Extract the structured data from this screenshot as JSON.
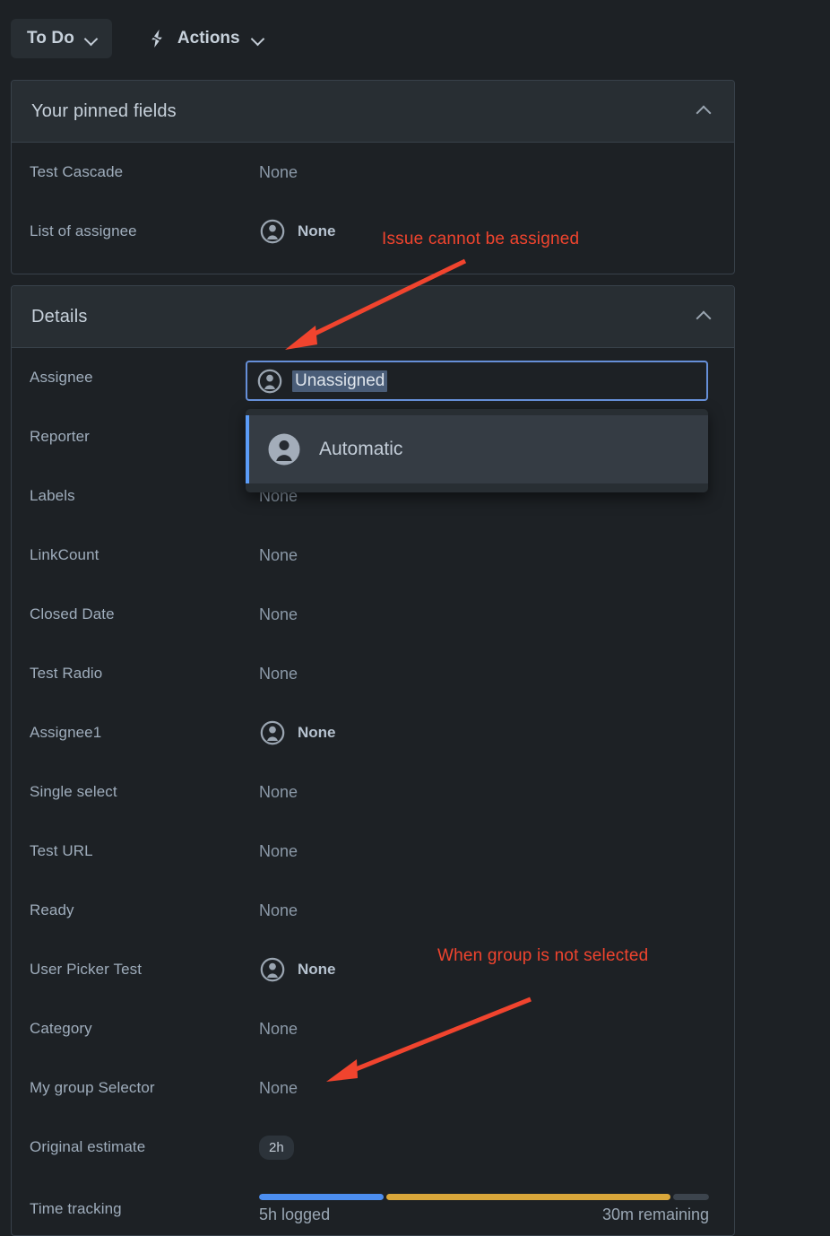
{
  "toolbar": {
    "status_label": "To Do",
    "status_chevron": "chevron-down-icon",
    "actions_label": "Actions",
    "actions_icon": "lightning-bolt-icon",
    "actions_chevron": "chevron-down-icon"
  },
  "pinned_panel": {
    "title": "Your pinned fields",
    "collapse_icon": "chevron-up-icon",
    "rows": [
      {
        "label": "Test Cascade",
        "value": "None",
        "avatar": false
      },
      {
        "label": "List of assignee",
        "value": "None",
        "avatar": true
      }
    ]
  },
  "details_panel": {
    "title": "Details",
    "collapse_icon": "chevron-up-icon",
    "rows": [
      {
        "label": "Assignee",
        "value": "",
        "avatar": false
      },
      {
        "label": "Reporter",
        "value": "",
        "avatar": false
      },
      {
        "label": "Labels",
        "value": "None",
        "avatar": false
      },
      {
        "label": "LinkCount",
        "value": "None",
        "avatar": false
      },
      {
        "label": "Closed Date",
        "value": "None",
        "avatar": false
      },
      {
        "label": "Test Radio",
        "value": "None",
        "avatar": false
      },
      {
        "label": "Assignee1",
        "value": "None",
        "avatar": true
      },
      {
        "label": "Single select",
        "value": "None",
        "avatar": false
      },
      {
        "label": "Test URL",
        "value": "None",
        "avatar": false
      },
      {
        "label": "Ready",
        "value": "None",
        "avatar": false
      },
      {
        "label": "User Picker Test",
        "value": "None",
        "avatar": true
      },
      {
        "label": "Category",
        "value": "None",
        "avatar": false
      },
      {
        "label": "My group Selector",
        "value": "None",
        "avatar": false
      }
    ],
    "original_estimate": {
      "label": "Original estimate",
      "value": "2h"
    },
    "time_tracking": {
      "label": "Time tracking",
      "logged": "5h logged",
      "remaining": "30m remaining",
      "segments": [
        {
          "name": "logged",
          "percent": 28,
          "color": "#4c8ef0"
        },
        {
          "name": "spent",
          "percent": 64,
          "color": "#d9a73a"
        },
        {
          "name": "remaining",
          "percent": 8,
          "color": "#3c444d"
        }
      ]
    }
  },
  "assignee_combobox": {
    "value": "Unassigned",
    "avatar_icon": "user-avatar-icon",
    "options": [
      {
        "label": "Automatic",
        "avatar_icon": "user-avatar-icon",
        "selected": true
      }
    ]
  },
  "annotations": [
    {
      "name": "annotation-issue-cannot-be-assigned",
      "text": "Issue cannot be assigned"
    },
    {
      "name": "annotation-group-not-selected",
      "text": "When group is not selected"
    }
  ],
  "colors": {
    "background": "#1d2125",
    "panel_header": "#282e33",
    "border": "#38414a",
    "annotation_red": "#f0442e",
    "focus_blue": "#668fd8",
    "accent_blue": "#5b9cf8",
    "logged_blue": "#4c8ef0",
    "spent_yellow": "#d9a73a"
  }
}
